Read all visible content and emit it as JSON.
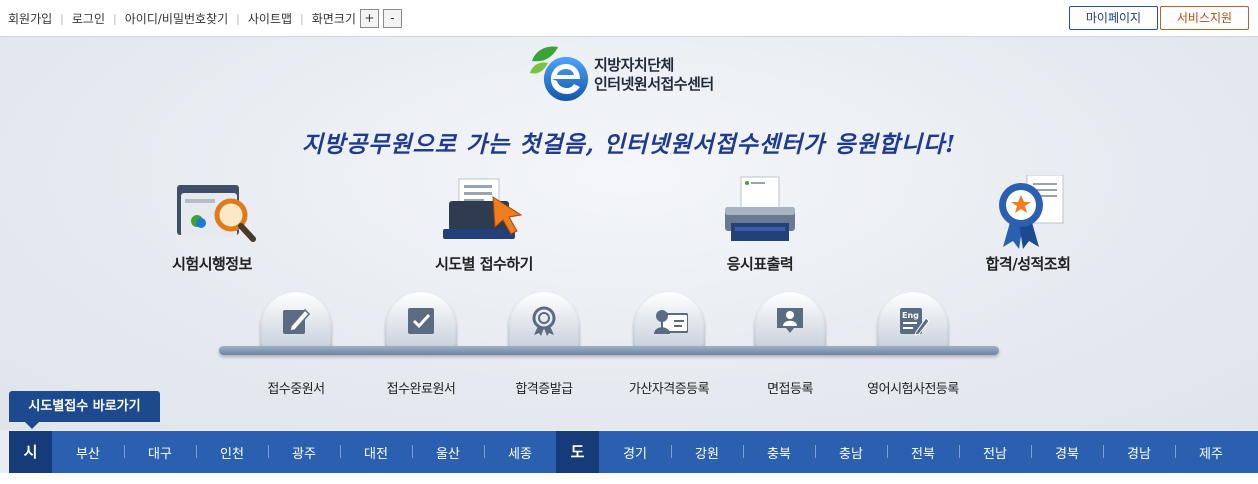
{
  "top_links": {
    "signup": "회원가입",
    "login": "로그인",
    "find_id_pw": "아이디/비밀번호찾기",
    "sitemap": "사이트맵",
    "screen_size": "화면크기",
    "zoom_in": "+",
    "zoom_out": "-"
  },
  "top_buttons": {
    "mypage": "마이페이지",
    "support": "서비스지원"
  },
  "logo": {
    "line1": "지방자치단체",
    "line2": "인터넷원서접수센터"
  },
  "slogan": "지방공무원으로 가는 첫걸음, 인터넷원서접수센터가 응원합니다!",
  "main_menu": [
    {
      "label": "시험시행정보",
      "icon": "folder-magnifier-icon"
    },
    {
      "label": "시도별 접수하기",
      "icon": "laptop-cursor-icon"
    },
    {
      "label": "응시표출력",
      "icon": "printer-icon"
    },
    {
      "label": "합격/성적조회",
      "icon": "award-certificate-icon"
    }
  ],
  "sub_menu": [
    {
      "label": "접수중원서",
      "icon": "pencil-icon"
    },
    {
      "label": "접수완료원서",
      "icon": "checkbox-icon"
    },
    {
      "label": "합격증발급",
      "icon": "medal-icon"
    },
    {
      "label": "가산자격증등록",
      "icon": "id-card-icon"
    },
    {
      "label": "면접등록",
      "icon": "person-icon"
    },
    {
      "label": "영어시험사전등록",
      "icon": "eng-document-icon"
    }
  ],
  "shortcut_label": "시도별접수 바로가기",
  "regions": {
    "si_label": "시",
    "si": [
      "부산",
      "대구",
      "인천",
      "광주",
      "대전",
      "울산",
      "세종"
    ],
    "do_label": "도",
    "do": [
      "경기",
      "강원",
      "충북",
      "충남",
      "전북",
      "전남",
      "경북",
      "경남",
      "제주"
    ]
  },
  "colors": {
    "nav_blue": "#2b5fb0",
    "nav_dark": "#153b78",
    "slogan": "#1f3b8f",
    "support_orange": "#b34c12"
  }
}
